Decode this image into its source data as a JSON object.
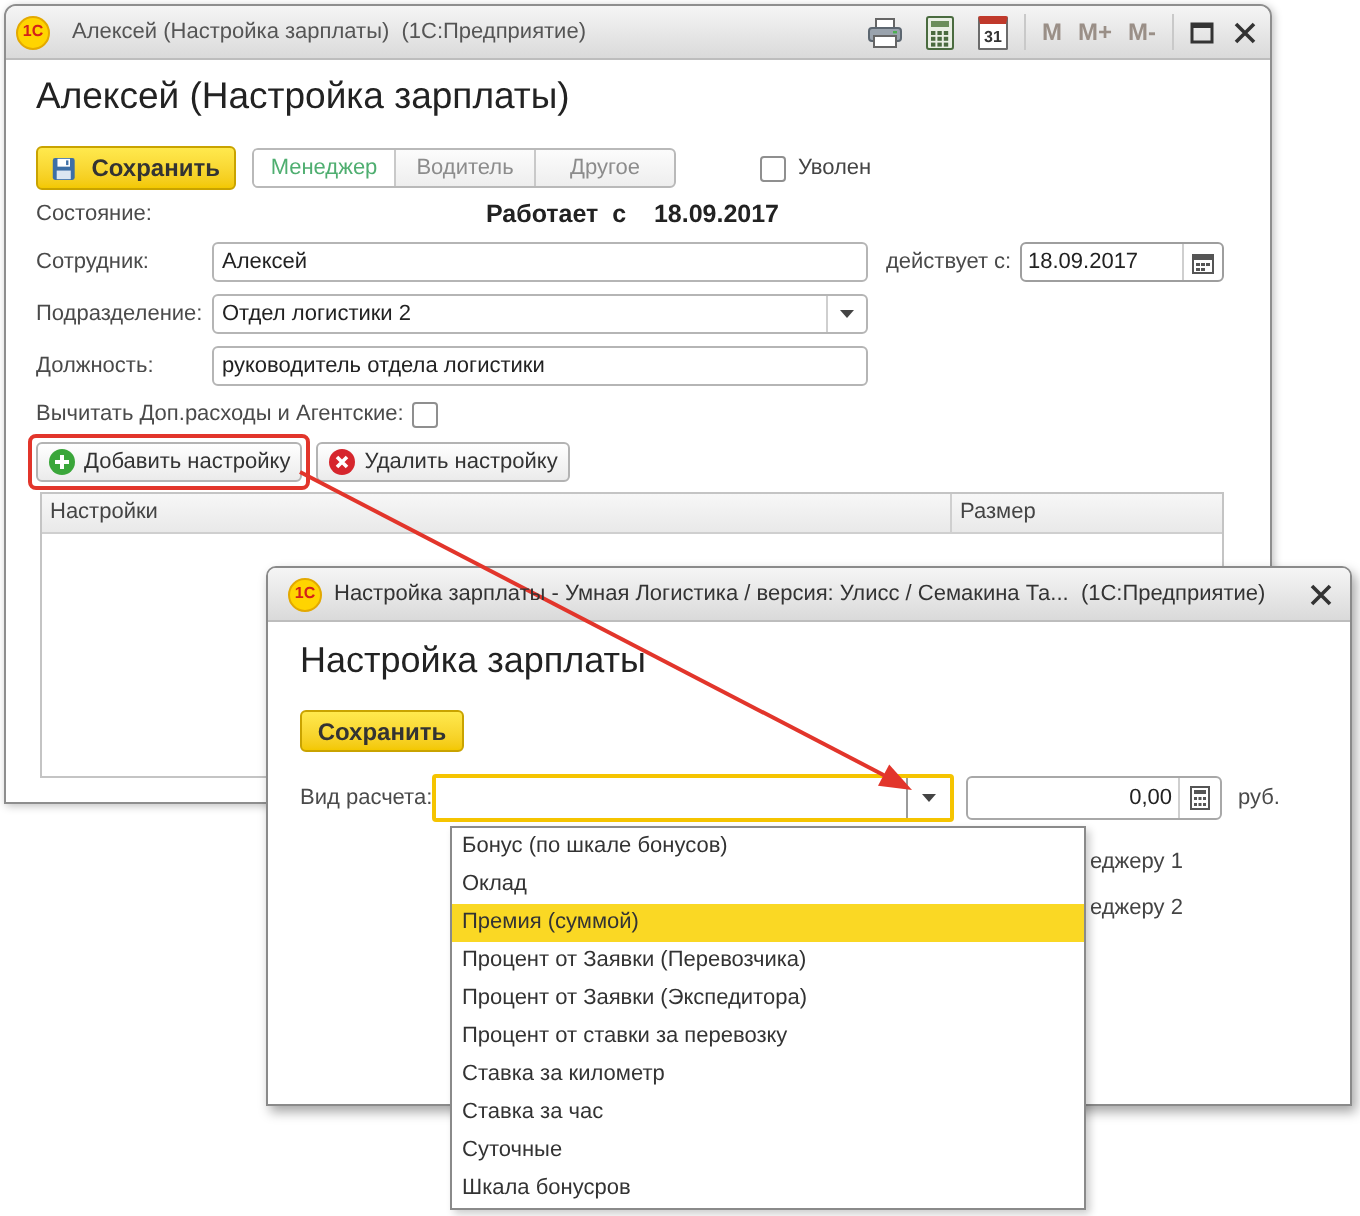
{
  "main_window": {
    "logo": "1С",
    "title": "Алексей (Настройка зарплаты)  (1С:Предприятие)",
    "tools": [
      {
        "kind": "print"
      },
      {
        "kind": "calculator"
      },
      {
        "kind": "calendar",
        "label": "31"
      }
    ],
    "memory_buttons": [
      {
        "label": "M",
        "disabled": true
      },
      {
        "label": "M+",
        "disabled": true
      },
      {
        "label": "M-",
        "disabled": true
      }
    ]
  },
  "form": {
    "heading": "Алексей (Настройка зарплаты)",
    "save_button": "Сохранить",
    "role_tabs": [
      {
        "label": "Менеджер",
        "selected": true
      },
      {
        "label": "Водитель",
        "selected": false
      },
      {
        "label": "Другое",
        "selected": false
      }
    ],
    "dismissed": {
      "label": "Уволен",
      "checked": false
    },
    "status": {
      "label": "Состояние:",
      "value": "Работает  с    18.09.2017"
    },
    "fields": [
      {
        "kind": "text",
        "label": "Сотрудник:",
        "value": "Алексей",
        "side": {
          "label": "действует с:",
          "value": "18.09.2017"
        }
      },
      {
        "kind": "select",
        "label": "Подразделение:",
        "value": "Отдел логистики 2"
      },
      {
        "kind": "text",
        "label": "Должность:",
        "value": "руководитель отдела логистики"
      }
    ],
    "deduct": {
      "label": "Вычитать Доп.расходы и Агентские:",
      "checked": false
    },
    "actions": [
      {
        "kind": "add",
        "label": "Добавить настройку",
        "highlighted": true
      },
      {
        "kind": "delete",
        "label": "Удалить настройку",
        "highlighted": false
      }
    ],
    "table": {
      "columns": [
        "Настройки",
        "Размер"
      ]
    }
  },
  "dialog": {
    "logo": "1С",
    "title": "Настройка зарплаты - Умная Логистика / версия: Улисс / Семакина Та...  (1С:Предприятие)",
    "heading": "Настройка зарплаты",
    "save_button": "Сохранить",
    "calc_type": {
      "label": "Вид расчета:",
      "focused": true,
      "options": [
        {
          "label": "Бонус (по шкале бонусов)",
          "selected": false
        },
        {
          "label": "Оклад",
          "selected": false
        },
        {
          "label": "Премия (суммой)",
          "selected": true
        },
        {
          "label": "Процент от Заявки (Перевозчика)",
          "selected": false
        },
        {
          "label": "Процент от Заявки (Экспедитора)",
          "selected": false
        },
        {
          "label": "Процент от ставки за перевозку",
          "selected": false
        },
        {
          "label": "Ставка за километр",
          "selected": false
        },
        {
          "label": "Ставка за час",
          "selected": false
        },
        {
          "label": "Суточные",
          "selected": false
        },
        {
          "label": "Шкала бонусров",
          "selected": false
        }
      ]
    },
    "amount": {
      "value": "0,00",
      "unit": "руб."
    },
    "partial_labels": [
      "еджеру 1",
      "еджеру 2"
    ]
  }
}
